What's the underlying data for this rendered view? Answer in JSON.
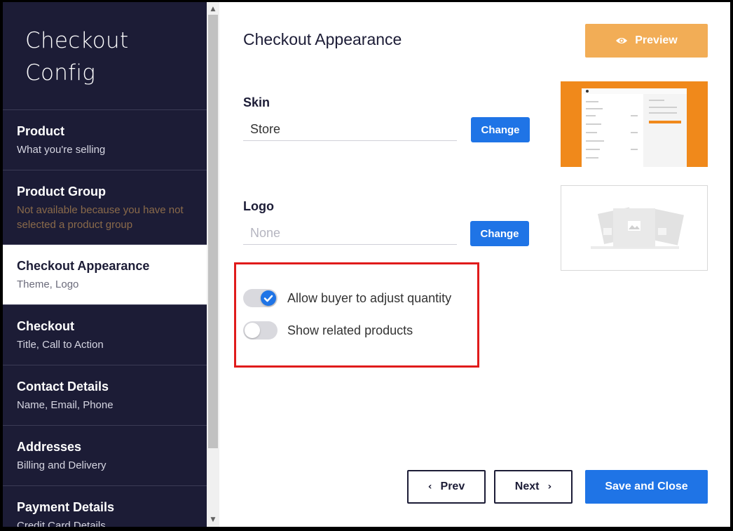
{
  "sidebar": {
    "brand_line1": "Checkout",
    "brand_line2": "Config",
    "items": [
      {
        "title": "Product",
        "subtitle": "What you're selling"
      },
      {
        "title": "Product Group",
        "subtitle": "Not available because you have not selected a product group"
      },
      {
        "title": "Checkout Appearance",
        "subtitle": "Theme, Logo"
      },
      {
        "title": "Checkout",
        "subtitle": "Title, Call to Action"
      },
      {
        "title": "Contact Details",
        "subtitle": "Name, Email, Phone"
      },
      {
        "title": "Addresses",
        "subtitle": "Billing and Delivery"
      },
      {
        "title": "Payment Details",
        "subtitle": "Credit Card Details"
      }
    ],
    "active_item": "Checkout Appearance"
  },
  "main": {
    "title": "Checkout Appearance",
    "preview_label": "Preview",
    "skin": {
      "label": "Skin",
      "value": "Store",
      "change_label": "Change"
    },
    "logo": {
      "label": "Logo",
      "placeholder": "None",
      "change_label": "Change"
    },
    "toggles": [
      {
        "label": "Allow buyer to adjust quantity",
        "on": true
      },
      {
        "label": "Show related products",
        "on": false
      }
    ],
    "prev_label": "Prev",
    "next_label": "Next",
    "save_label": "Save and Close"
  },
  "icons": {
    "preview": "eye-icon",
    "prev": "chevron-left-icon",
    "next": "chevron-right-icon",
    "check": "check-icon",
    "logo_placeholder": "image-placeholder-icon"
  },
  "colors": {
    "sidebar_bg": "#1c1c36",
    "primary": "#1f74e6",
    "preview": "#f2ad56",
    "skin_accent": "#f0891b",
    "highlight": "#e01b1b"
  }
}
